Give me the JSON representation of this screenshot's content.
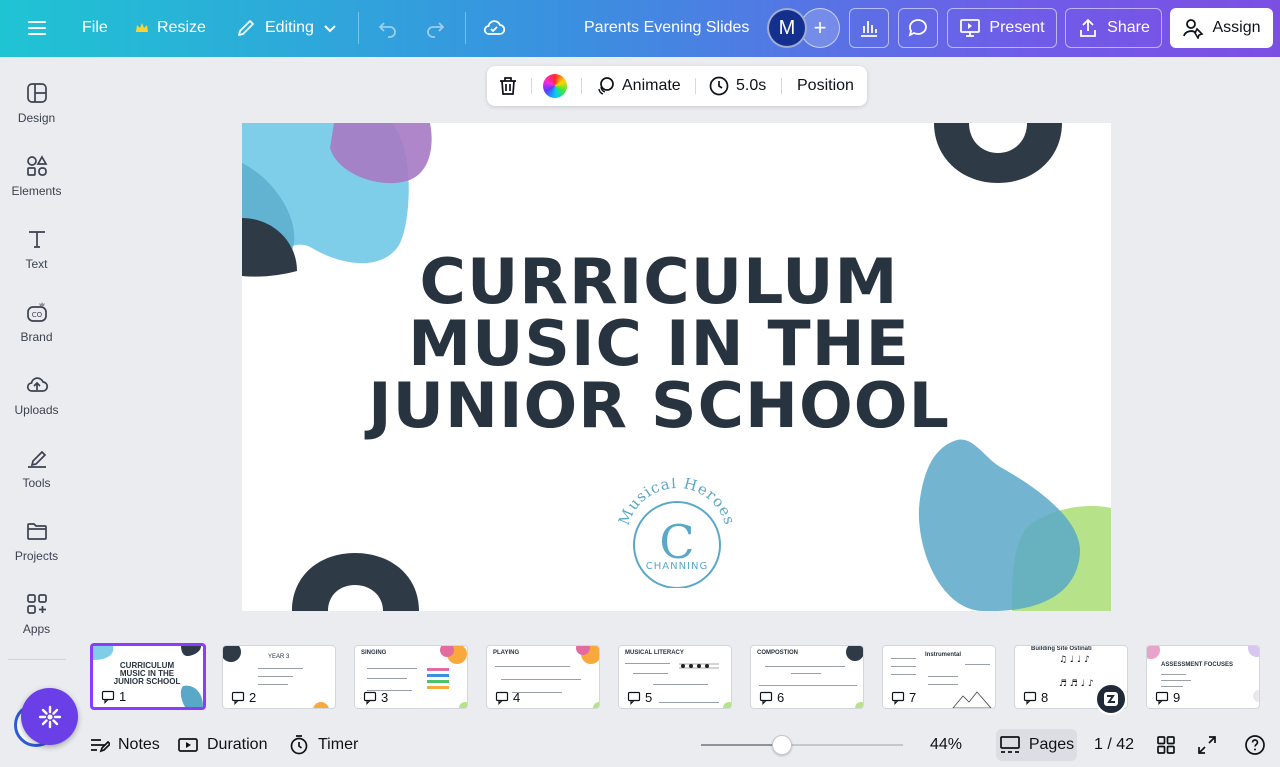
{
  "header": {
    "file_label": "File",
    "resize_label": "Resize",
    "editing_label": "Editing",
    "doc_title": "Parents Evening Slides",
    "avatar_initial": "M",
    "present_label": "Present",
    "share_label": "Share",
    "assign_label": "Assign"
  },
  "sidebar": {
    "items": [
      {
        "label": "Design",
        "icon": "layout-icon"
      },
      {
        "label": "Elements",
        "icon": "shapes-icon"
      },
      {
        "label": "Text",
        "icon": "text-icon"
      },
      {
        "label": "Brand",
        "icon": "brand-icon"
      },
      {
        "label": "Uploads",
        "icon": "cloud-upload-icon"
      },
      {
        "label": "Tools",
        "icon": "draw-icon"
      },
      {
        "label": "Projects",
        "icon": "folder-icon"
      },
      {
        "label": "Apps",
        "icon": "apps-icon"
      }
    ]
  },
  "toolbar": {
    "animate_label": "Animate",
    "duration_label": "5.0s",
    "position_label": "Position"
  },
  "slide": {
    "title_lines": [
      "CURRICULUM",
      "MUSIC IN THE",
      "JUNIOR SCHOOL"
    ],
    "logo_arc_text": "Musical Heroes",
    "logo_letter": "C",
    "logo_name": "CHANNING"
  },
  "filmstrip": {
    "thumbs": [
      {
        "num": "1",
        "title": "CURRICULUM MUSIC IN THE JUNIOR SCHOOL"
      },
      {
        "num": "2",
        "title": "YEAR 3"
      },
      {
        "num": "3",
        "title": "SINGING"
      },
      {
        "num": "4",
        "title": "PLAYING"
      },
      {
        "num": "5",
        "title": "MUSICAL LITERACY"
      },
      {
        "num": "6",
        "title": "COMPOSTION"
      },
      {
        "num": "7",
        "title": "Instrumental"
      },
      {
        "num": "8",
        "title": "Building Site Ostinati"
      },
      {
        "num": "9",
        "title": "ASSESSMENT FOCUSES"
      }
    ]
  },
  "footer": {
    "notes_label": "Notes",
    "duration_label": "Duration",
    "timer_label": "Timer",
    "zoom": "44%",
    "zoom_fraction": 0.4,
    "pages_label": "Pages",
    "page_indicator": "1 / 42"
  },
  "colors": {
    "accent": "#8b3dff",
    "title_text": "#283340",
    "blob_blue": "#7ecde9",
    "blob_purple": "#a77cc4",
    "blob_green": "#b6e38a",
    "ring_dark": "#2f3a47"
  }
}
